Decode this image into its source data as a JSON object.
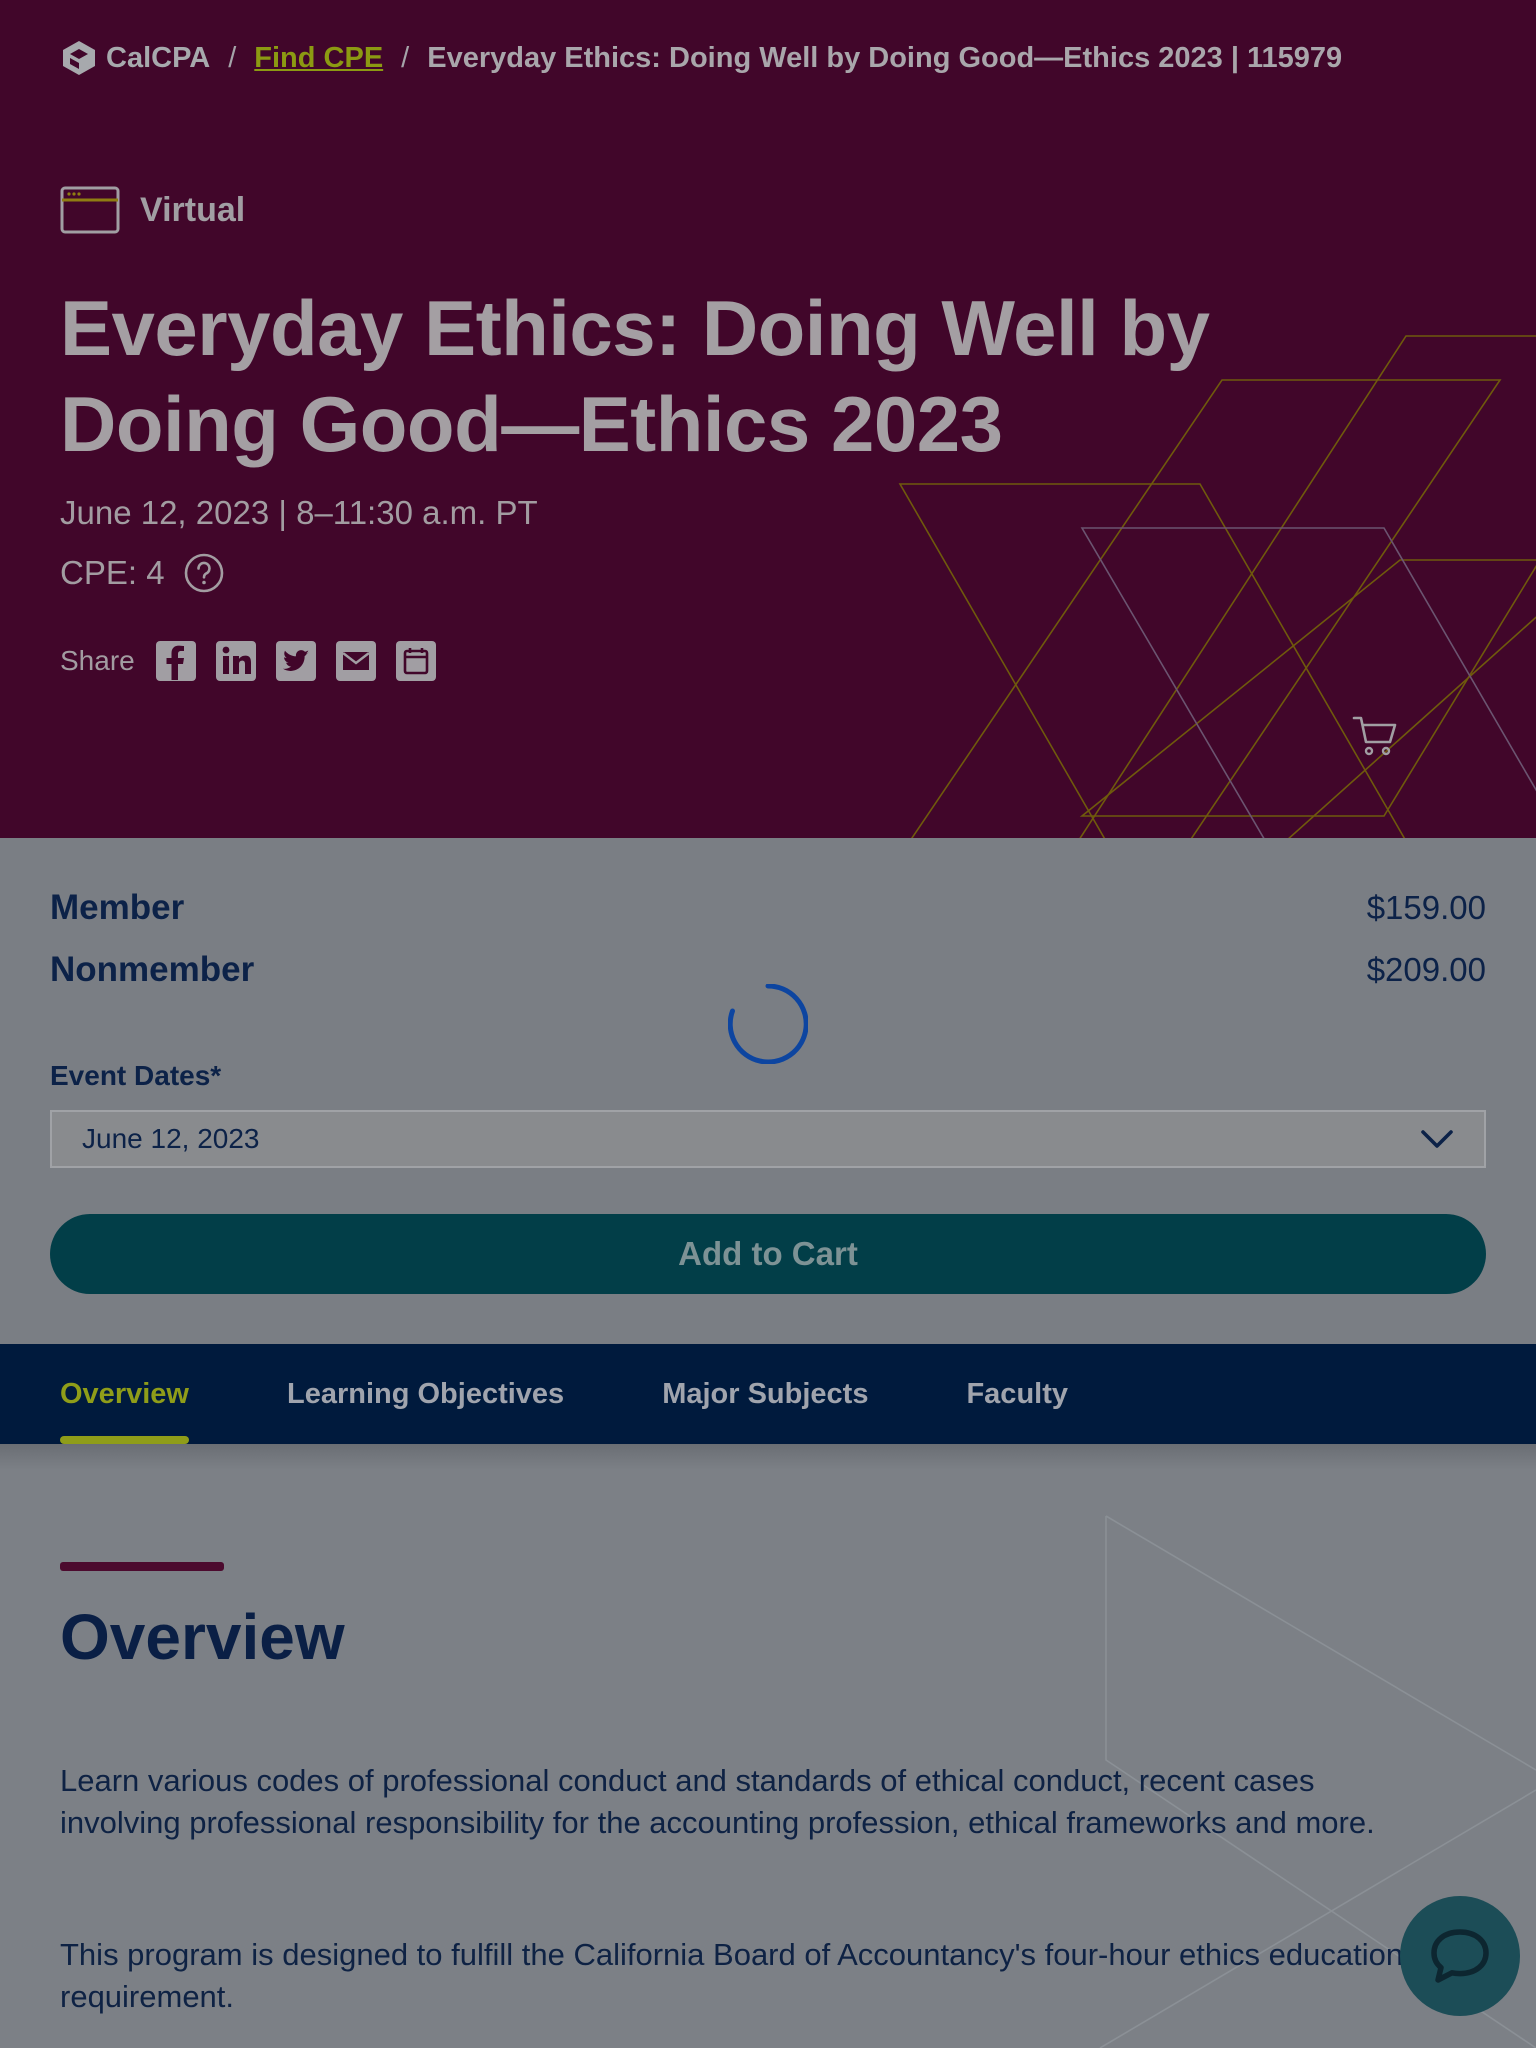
{
  "breadcrumb": {
    "logo_text": "CalCPA",
    "separator": "/",
    "link": "Find CPE",
    "current": "Everyday Ethics: Doing Well by Doing Good—Ethics 2023 | 115979"
  },
  "event": {
    "format_icon": "browser-window-icon",
    "format": "Virtual",
    "title": "Everyday Ethics: Doing Well by Doing Good—Ethics 2023",
    "when": "June 12, 2023 | 8–11:30 a.m. PT",
    "cpe": "CPE: 4",
    "share_label": "Share",
    "share_icons": [
      "facebook-icon",
      "linkedin-icon",
      "twitter-icon",
      "email-icon",
      "calendar-icon"
    ]
  },
  "pricing": {
    "member_label": "Member",
    "member_price": "$159.00",
    "nonmember_label": "Nonmember",
    "nonmember_price": "$209.00",
    "dates_label": "Event Dates*",
    "selected_date": "June 12, 2023",
    "add_to_cart": "Add to Cart"
  },
  "tabs": {
    "items": [
      "Overview",
      "Learning Objectives",
      "Major Subjects",
      "Faculty"
    ],
    "active": "Overview"
  },
  "overview": {
    "heading": "Overview",
    "paragraph1": "Learn various codes of professional conduct and standards of ethical conduct, recent cases involving professional responsibility for the accounting profession, ethical frameworks and more.",
    "paragraph2": "This program is designed to fulfill the California Board of Accountancy's four-hour ethics education requirement."
  },
  "colors": {
    "hero_bg": "#41062a",
    "accent_green": "#8f9d19",
    "navy": "#001a3d",
    "teal_button": "#023e48",
    "overlay_gray": "#7c8086"
  }
}
